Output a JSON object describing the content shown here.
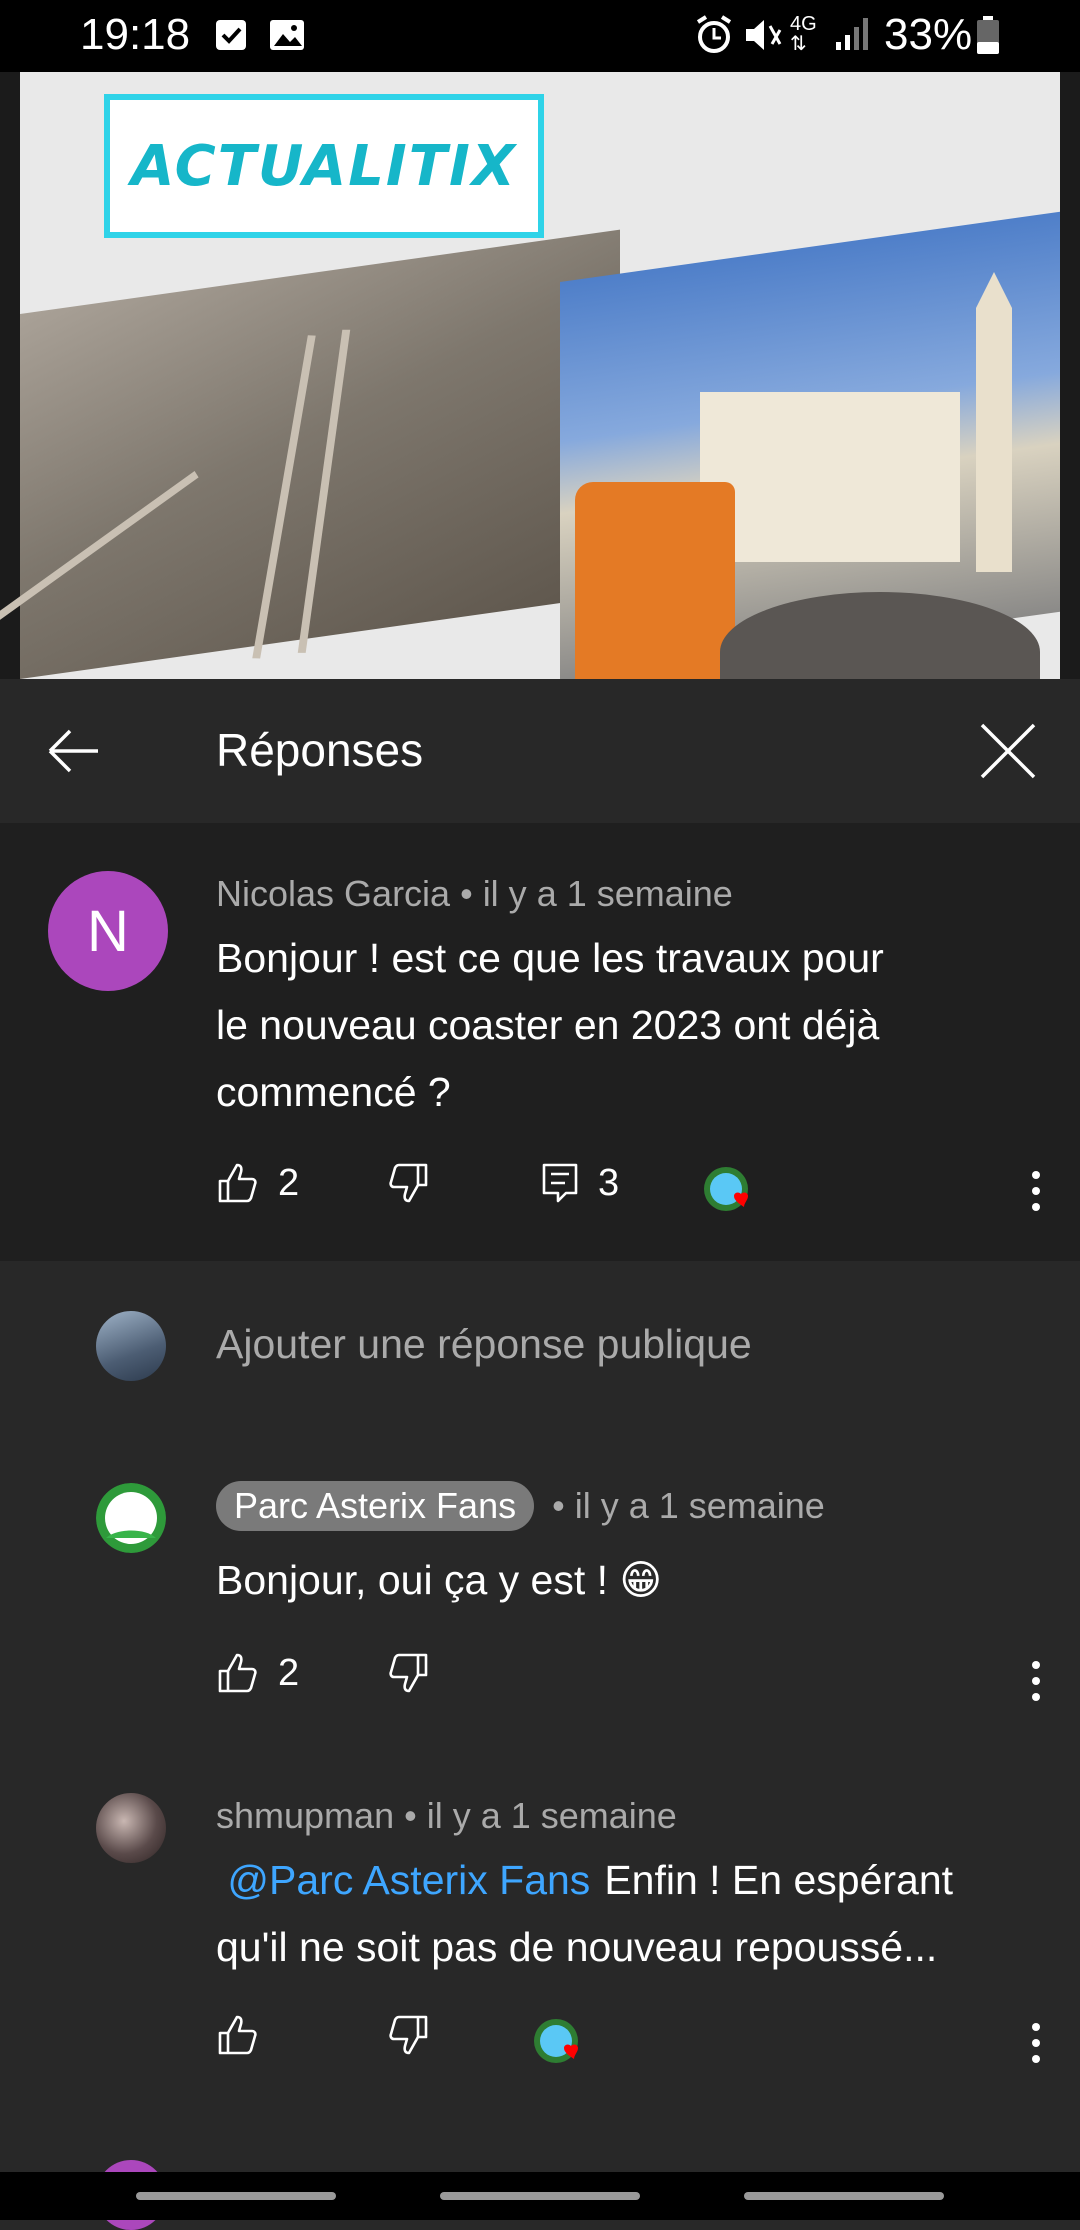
{
  "status_bar": {
    "time": "19:18",
    "network": "4G",
    "battery": "33%",
    "icons": [
      "checkbox-icon",
      "image-icon",
      "alarm-icon",
      "mute-icon",
      "network-4g-icon",
      "signal-icon",
      "battery-icon"
    ]
  },
  "video": {
    "logo_text": "ACTUALITIX"
  },
  "header": {
    "title": "Réponses",
    "back_icon": "arrow-left-icon",
    "close_icon": "close-icon"
  },
  "parent_comment": {
    "avatar_letter": "N",
    "avatar_color": "#ab47bc",
    "author": "Nicolas Garcia",
    "time": "il y a 1 semaine",
    "text_line1": "Bonjour ! est ce que les travaux pour",
    "text_line2": "le nouveau coaster en 2023 ont déjà",
    "text_line3": "commencé ?",
    "likes": "2",
    "replies": "3"
  },
  "reply_input": {
    "placeholder": "Ajouter une réponse publique"
  },
  "replies": [
    {
      "author": "Parc Asterix Fans",
      "time": "il y a 1 semaine",
      "text": "Bonjour, oui ça y est ! 😁",
      "likes": "2"
    },
    {
      "author": "shmupman",
      "time": "il y a 1 semaine",
      "mention": "@Parc Asterix Fans",
      "text_line1": "Enfin ! En espérant",
      "text_line2": "qu'il ne soit pas de nouveau repoussé..."
    }
  ],
  "separator": " • ",
  "colors": {
    "background": "#282828",
    "parent_background": "#1f1f1f",
    "mention": "#3ea6ff",
    "heart": "#ff0000",
    "secondary_text": "#aaaaaa"
  }
}
